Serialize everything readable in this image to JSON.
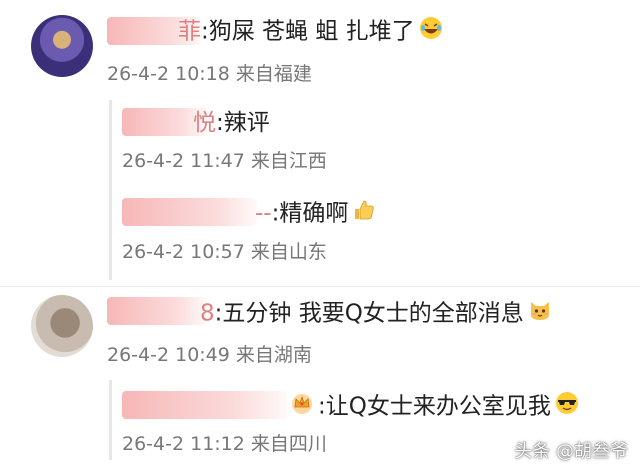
{
  "comments": [
    {
      "name_tail": "菲",
      "text": ":狗屎 苍蝇 蛆 扎堆了",
      "emoji": "laughing-crying-emoji",
      "meta": "26-4-2 10:18 来自福建",
      "replies": [
        {
          "name_tail": "悦",
          "text": ":辣评",
          "meta": "26-4-2 11:47 来自江西"
        },
        {
          "name_tail": "--",
          "text": ":精确啊",
          "emoji": "thumbs-up-emoji",
          "meta": "26-4-2 10:57 来自山东"
        }
      ]
    },
    {
      "name_tail": "8",
      "text": ":五分钟 我要Q女士的全部消息",
      "emoji": "cat-emoji",
      "meta": "26-4-2 10:49 来自湖南",
      "replies": [
        {
          "name_tail": "",
          "text": ":让Q女士来办公室见我",
          "badge": "crown-badge-icon",
          "emoji": "sunglasses-emoji",
          "meta": "26-4-2 11:12 来自四川"
        }
      ]
    }
  ],
  "watermark": "头条 @胡叁爷"
}
